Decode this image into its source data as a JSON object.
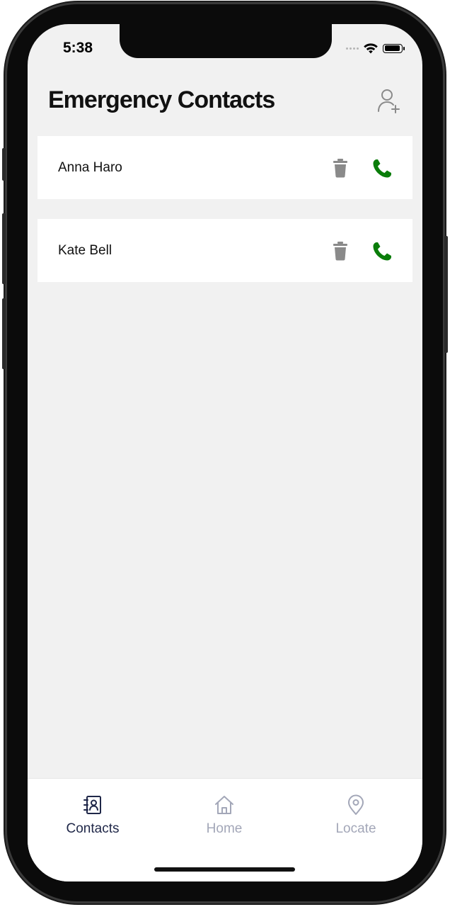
{
  "status_bar": {
    "time": "5:38",
    "battery_level": 0.92
  },
  "header": {
    "title": "Emergency Contacts",
    "add_icon": "add-person-icon"
  },
  "contacts": [
    {
      "name": "Anna Haro"
    },
    {
      "name": "Kate Bell"
    }
  ],
  "contact_actions": {
    "delete_icon": "trash-icon",
    "call_icon": "phone-icon"
  },
  "tabs": [
    {
      "label": "Contacts",
      "icon": "contacts-book-icon",
      "active": true
    },
    {
      "label": "Home",
      "icon": "home-icon",
      "active": false
    },
    {
      "label": "Locate",
      "icon": "location-pin-icon",
      "active": false
    }
  ],
  "colors": {
    "background": "#f1f1f1",
    "call": "#0a7d0a",
    "delete": "#8a8a8a",
    "tab_active": "#1f2748",
    "tab_inactive": "#a3a7b8"
  }
}
